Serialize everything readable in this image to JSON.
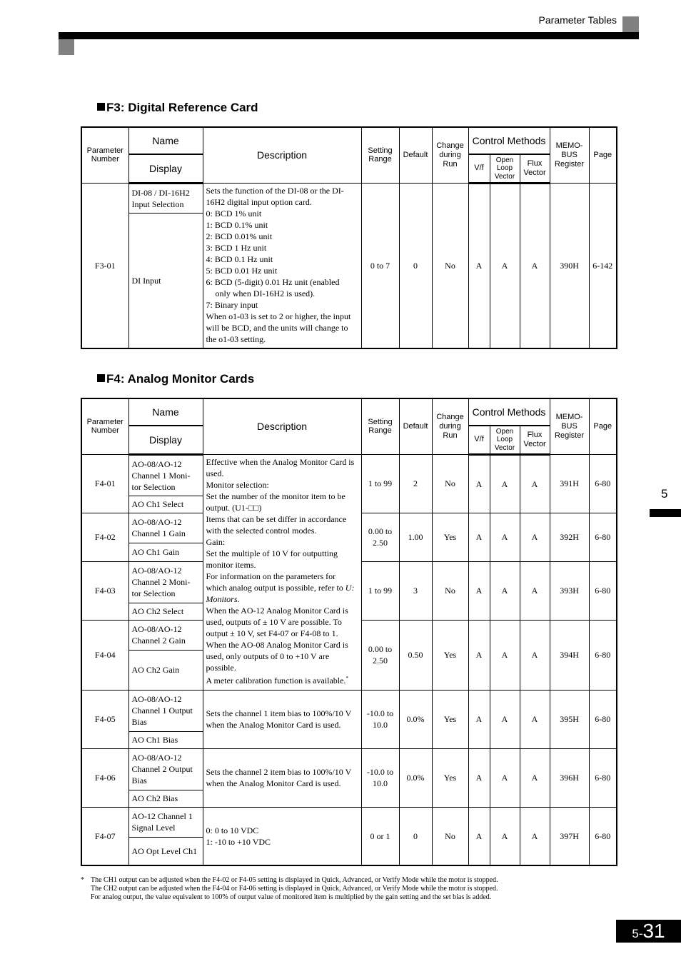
{
  "header": {
    "section_label": "Parameter Tables"
  },
  "columns": {
    "param_number": "Parameter Number",
    "name": "Name",
    "display": "Display",
    "description": "Description",
    "setting_range": "Setting Range",
    "default": "Default",
    "change_during_run": "Change during Run",
    "control_methods": "Control Methods",
    "vf": "V/f",
    "open_loop_vector": "Open Loop Vector",
    "flux_vector": "Flux Vector",
    "memobus_register": "MEMO-BUS Register",
    "page": "Page"
  },
  "f3": {
    "title": "F3: Digital Reference Card",
    "rows": [
      {
        "param": "F3-01",
        "name": "DI-08 / DI-16H2 Input Selection",
        "display": "DI Input",
        "description": {
          "intro": "Sets the function of the DI-08 or the DI-16H2 digital input option card.",
          "options": [
            "0:  BCD 1% unit",
            "1:  BCD 0.1% unit",
            "2:  BCD 0.01% unit",
            "3:  BCD 1 Hz unit",
            "4:  BCD 0.1 Hz unit",
            "5:  BCD 0.01 Hz unit",
            "6:  BCD (5-digit) 0.01 Hz unit (enabled",
            "only when DI-16H2 is used).",
            "7:   Binary input"
          ],
          "note": "When o1-03 is set to 2 or higher, the input will be BCD, and the units will change to the o1-03 setting."
        },
        "range": "0 to 7",
        "default": "0",
        "change": "No",
        "vf": "A",
        "olv": "A",
        "fv": "A",
        "register": "390H",
        "page": "6-142"
      }
    ]
  },
  "f4": {
    "title": "F4: Analog Monitor Cards",
    "shared_description": {
      "l1": "Effective when the Analog Monitor Card is used.",
      "l2": "Monitor selection:",
      "l3": "Set the number of the monitor item to be output. (U1-□□)",
      "l4": "Items that can be set differ in accordance with the selected control modes.",
      "l5": "Gain:",
      "l6": "Set the multiple of 10 V for outputting monitor items.",
      "l7": "For information on the parameters for which analog output is possible, refer to",
      "l7_ref": "U: Monitors",
      "l7_end": ".",
      "l8": "When the AO-12 Analog Monitor Card is used, outputs of ± 10 V are possible. To output ± 10 V, set F4-07 or F4-08 to 1.",
      "l9": "When the AO-08 Analog Monitor Card is used, only outputs of 0 to +10 V are possible.",
      "l10": "A meter calibration function is available.",
      "l10_mark": "*"
    },
    "rows": [
      {
        "param": "F4-01",
        "name": "AO-08/AO-12 Channel 1 Moni-tor Selection",
        "display": "AO Ch1 Select",
        "range": "1 to 99",
        "default": "2",
        "change": "No",
        "vf": "A",
        "olv": "A",
        "fv": "A",
        "register": "391H",
        "page": "6-80"
      },
      {
        "param": "F4-02",
        "name": "AO-08/AO-12 Channel 1 Gain",
        "display": "AO Ch1 Gain",
        "range": "0.00 to 2.50",
        "default": "1.00",
        "change": "Yes",
        "vf": "A",
        "olv": "A",
        "fv": "A",
        "register": "392H",
        "page": "6-80"
      },
      {
        "param": "F4-03",
        "name": "AO-08/AO-12 Channel 2 Moni-tor Selection",
        "display": "AO Ch2 Select",
        "range": "1 to 99",
        "default": "3",
        "change": "No",
        "vf": "A",
        "olv": "A",
        "fv": "A",
        "register": "393H",
        "page": "6-80"
      },
      {
        "param": "F4-04",
        "name": "AO-08/AO-12 Channel 2 Gain",
        "display": "AO Ch2 Gain",
        "range": "0.00 to 2.50",
        "default": "0.50",
        "change": "Yes",
        "vf": "A",
        "olv": "A",
        "fv": "A",
        "register": "394H",
        "page": "6-80"
      },
      {
        "param": "F4-05",
        "name": "AO-08/AO-12 Channel 1 Output Bias",
        "display": "AO Ch1 Bias",
        "description": "Sets the channel 1 item bias to 100%/10 V when the Analog Monitor Card is used.",
        "range": "-10.0 to 10.0",
        "default": "0.0%",
        "change": "Yes",
        "vf": "A",
        "olv": "A",
        "fv": "A",
        "register": "395H",
        "page": "6-80"
      },
      {
        "param": "F4-06",
        "name": "AO-08/AO-12 Channel 2 Output Bias",
        "display": "AO Ch2 Bias",
        "description": "Sets the channel 2 item bias to 100%/10 V when the Analog Monitor Card is used.",
        "range": "-10.0 to 10.0",
        "default": "0.0%",
        "change": "Yes",
        "vf": "A",
        "olv": "A",
        "fv": "A",
        "register": "396H",
        "page": "6-80"
      },
      {
        "param": "F4-07",
        "name": "AO-12 Channel 1 Signal Level",
        "display": "AO Opt Level Ch1",
        "description_lines": [
          "0:  0 to 10 VDC",
          "1:  -10 to +10 VDC"
        ],
        "range": "0 or 1",
        "default": "0",
        "change": "No",
        "vf": "A",
        "olv": "A",
        "fv": "A",
        "register": "397H",
        "page": "6-80"
      }
    ]
  },
  "footnote": {
    "mark": "*",
    "lines": [
      "The CH1 output can be adjusted when the F4-02 or F4-05 setting is displayed in Quick, Advanced, or Verify Mode while the motor is stopped.",
      "The CH2 output can be adjusted when the F4-04 or F4-06 setting is displayed in Quick, Advanced, or Verify Mode while the motor is stopped.",
      "For analog output, the value equivalent to 100% of output value of monitored item is multiplied by the gain setting and the set bias is added."
    ]
  },
  "chapter_tab": "5",
  "page_number": {
    "prefix": "5-",
    "number": "31"
  }
}
